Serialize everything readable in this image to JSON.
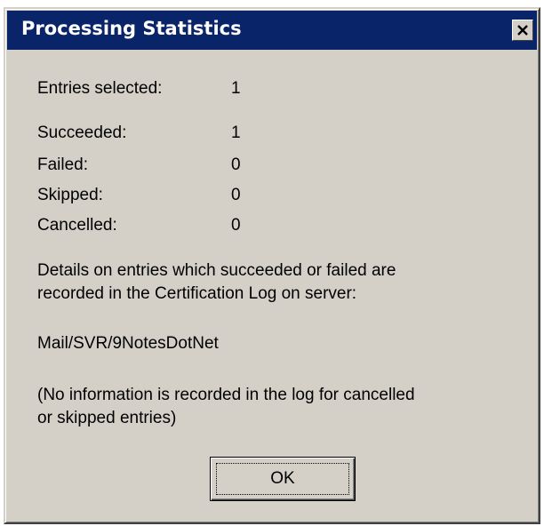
{
  "dialog": {
    "title": "Processing Statistics",
    "close_icon": "close-icon"
  },
  "stats": {
    "entries_selected": {
      "label": "Entries selected:",
      "value": "1"
    },
    "succeeded": {
      "label": "Succeeded:",
      "value": "1"
    },
    "failed": {
      "label": "Failed:",
      "value": "0"
    },
    "skipped": {
      "label": "Skipped:",
      "value": "0"
    },
    "cancelled": {
      "label": "Cancelled:",
      "value": "0"
    }
  },
  "details": {
    "line1": "Details on entries which succeeded or failed are",
    "line2": "recorded in the Certification Log on server:"
  },
  "server_name": "Mail/SVR/9NotesDotNet",
  "note": {
    "line1": "(No information is recorded in the log for cancelled",
    "line2": "or skipped entries)"
  },
  "buttons": {
    "ok_label": "OK"
  },
  "colors": {
    "titlebar": "#0a246a",
    "dialog_face": "#d4d0c8"
  }
}
